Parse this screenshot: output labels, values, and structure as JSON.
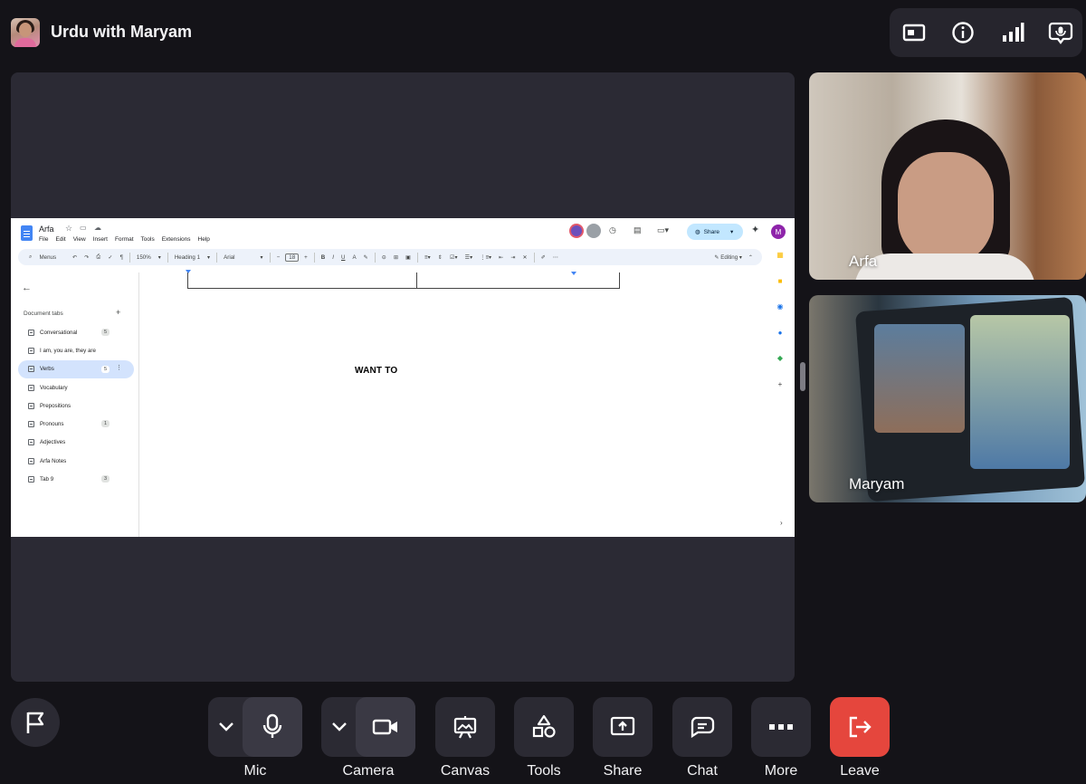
{
  "header": {
    "meeting_title": "Urdu with Maryam"
  },
  "shared_screen": {
    "doc_name": "Arfa",
    "menu": [
      "File",
      "Edit",
      "View",
      "Insert",
      "Format",
      "Tools",
      "Extensions",
      "Help"
    ],
    "share_label": "Share",
    "user_initial": "M",
    "toolbar": {
      "menus_label": "Menus",
      "zoom": "150%",
      "style": "Heading 1",
      "font": "Arial",
      "font_size": "18",
      "mode": "Editing"
    },
    "tabs_header": "Document tabs",
    "tabs": [
      {
        "label": "Conversational",
        "badge": "5",
        "active": false
      },
      {
        "label": "I am, you are, they are",
        "badge": "",
        "active": false
      },
      {
        "label": "Verbs",
        "badge": "5",
        "active": true
      },
      {
        "label": "Vocabulary",
        "badge": "",
        "active": false
      },
      {
        "label": "Prepositions",
        "badge": "",
        "active": false
      },
      {
        "label": "Pronouns",
        "badge": "1",
        "active": false
      },
      {
        "label": "Adjectives",
        "badge": "",
        "active": false
      },
      {
        "label": "Arfa Notes",
        "badge": "",
        "active": false
      },
      {
        "label": "Tab 9",
        "badge": "3",
        "active": false
      }
    ],
    "body_text": "WANT TO"
  },
  "participants": [
    {
      "name": "Arfa"
    },
    {
      "name": "Maryam"
    }
  ],
  "controls": {
    "mic": "Mic",
    "camera": "Camera",
    "canvas": "Canvas",
    "tools": "Tools",
    "share": "Share",
    "chat": "Chat",
    "more": "More",
    "leave": "Leave"
  },
  "colors": {
    "background": "#141318",
    "stage": "#2b2a34",
    "leave": "#e5463d",
    "share_button": "#c2e7ff"
  }
}
